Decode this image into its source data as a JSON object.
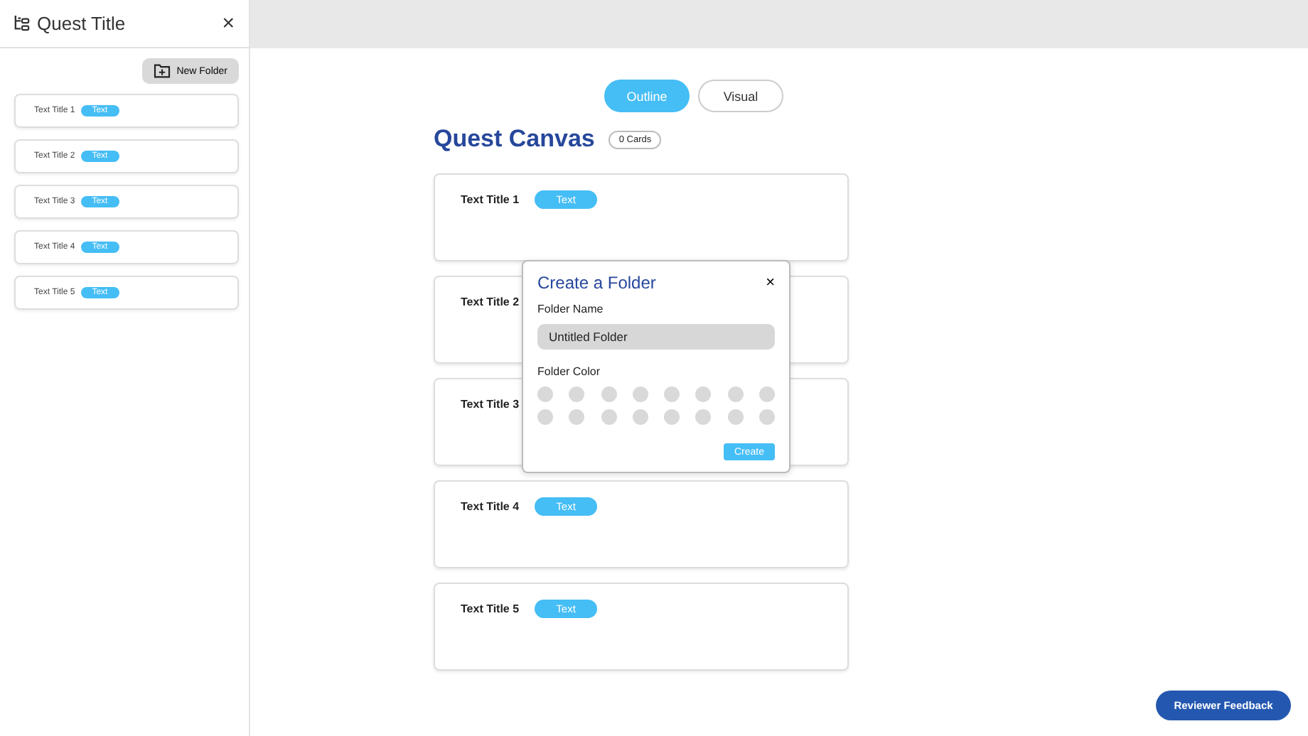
{
  "sidebar": {
    "title": "Quest Title",
    "close": "×",
    "new_folder": "New Folder",
    "items": [
      {
        "title": "Text Title 1",
        "tag": "Text"
      },
      {
        "title": "Text Title 2",
        "tag": "Text"
      },
      {
        "title": "Text Title 3",
        "tag": "Text"
      },
      {
        "title": "Text Title 4",
        "tag": "Text"
      },
      {
        "title": "Text Title 5",
        "tag": "Text"
      }
    ]
  },
  "tabs": [
    {
      "label": "Outline",
      "selected": true
    },
    {
      "label": "Visual",
      "selected": false
    }
  ],
  "canvas": {
    "title": "Quest Canvas",
    "count": "0 Cards",
    "cards": [
      {
        "title": "Text Title 1",
        "tag": "Text"
      },
      {
        "title": "Text Title 2"
      },
      {
        "title": "Text Title 3"
      },
      {
        "title": "Text Title 4",
        "tag": "Text"
      },
      {
        "title": "Text Title 5",
        "tag": "Text"
      }
    ]
  },
  "dialog": {
    "title": "Create a Folder",
    "close": "×",
    "name_label": "Folder Name",
    "name_value": "Untitled Folder",
    "color_label": "Folder Color",
    "create": "Create"
  },
  "feedback_button": "Reviewer Feedback"
}
